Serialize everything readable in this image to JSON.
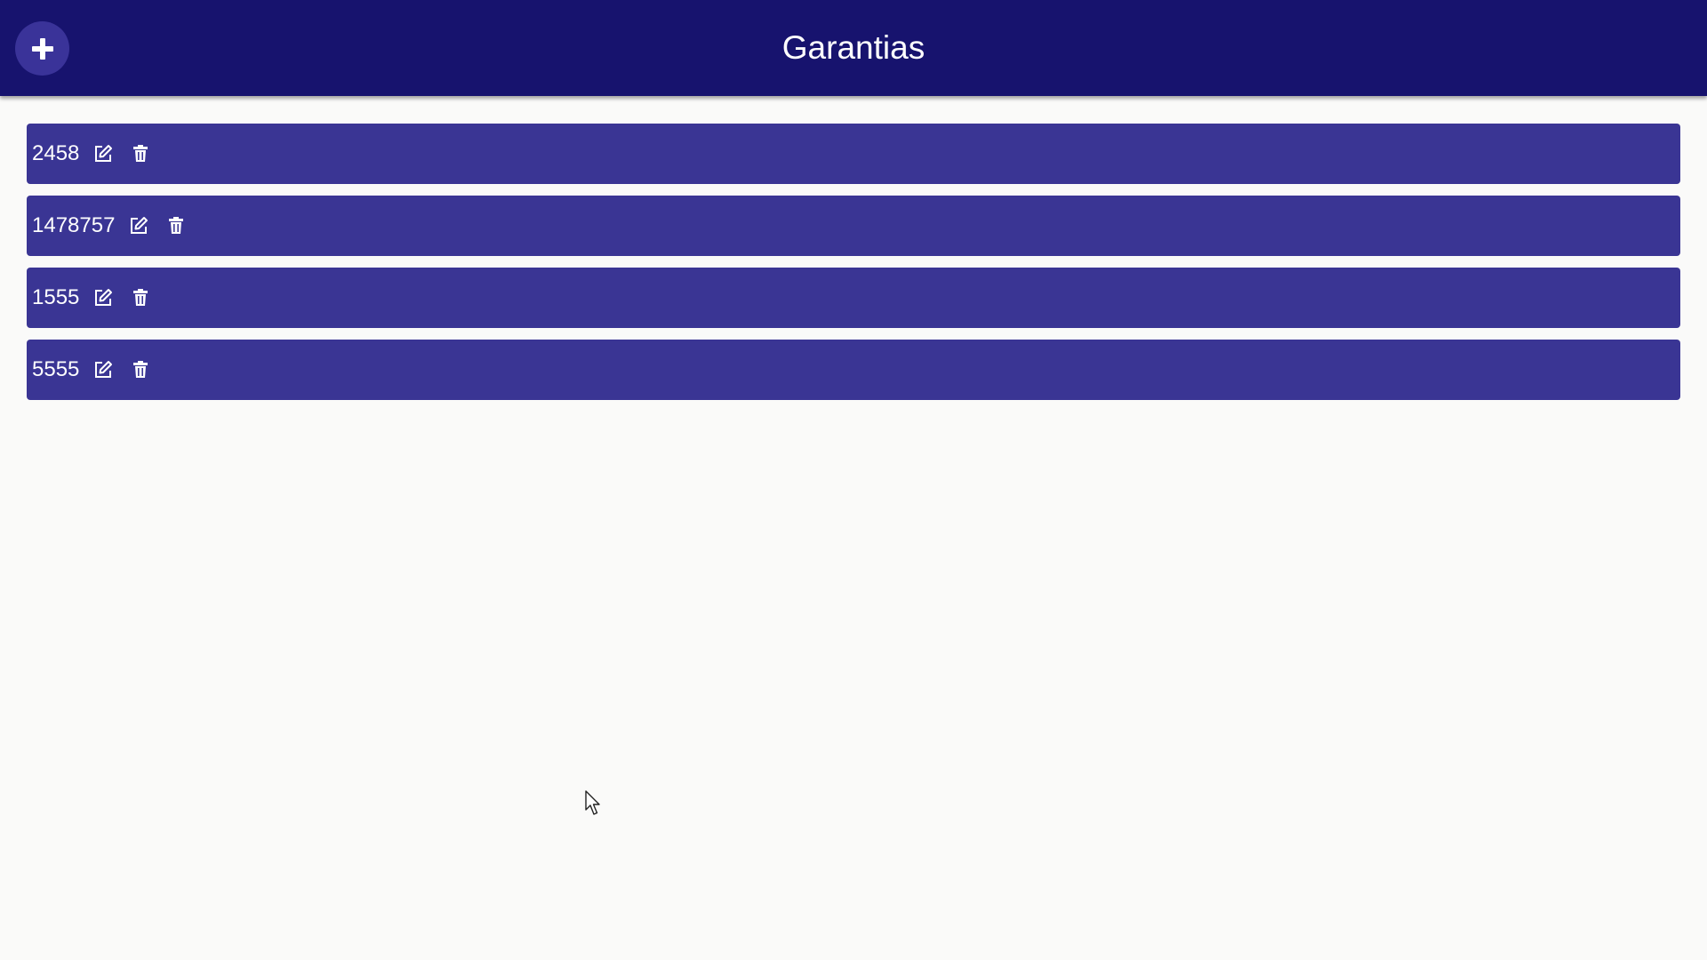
{
  "header": {
    "title": "Garantias",
    "add_icon": "plus-icon"
  },
  "items": [
    {
      "label": "2458",
      "edit_icon": "edit-icon",
      "delete_icon": "trash-icon"
    },
    {
      "label": "1478757",
      "edit_icon": "edit-icon",
      "delete_icon": "trash-icon"
    },
    {
      "label": "1555",
      "edit_icon": "edit-icon",
      "delete_icon": "trash-icon"
    },
    {
      "label": "5555",
      "edit_icon": "edit-icon",
      "delete_icon": "trash-icon"
    }
  ],
  "colors": {
    "header_bg": "#17136e",
    "add_button_bg": "#3a3399",
    "item_bg": "#3a3594",
    "page_bg": "#fafaf9",
    "text": "#ffffff"
  }
}
